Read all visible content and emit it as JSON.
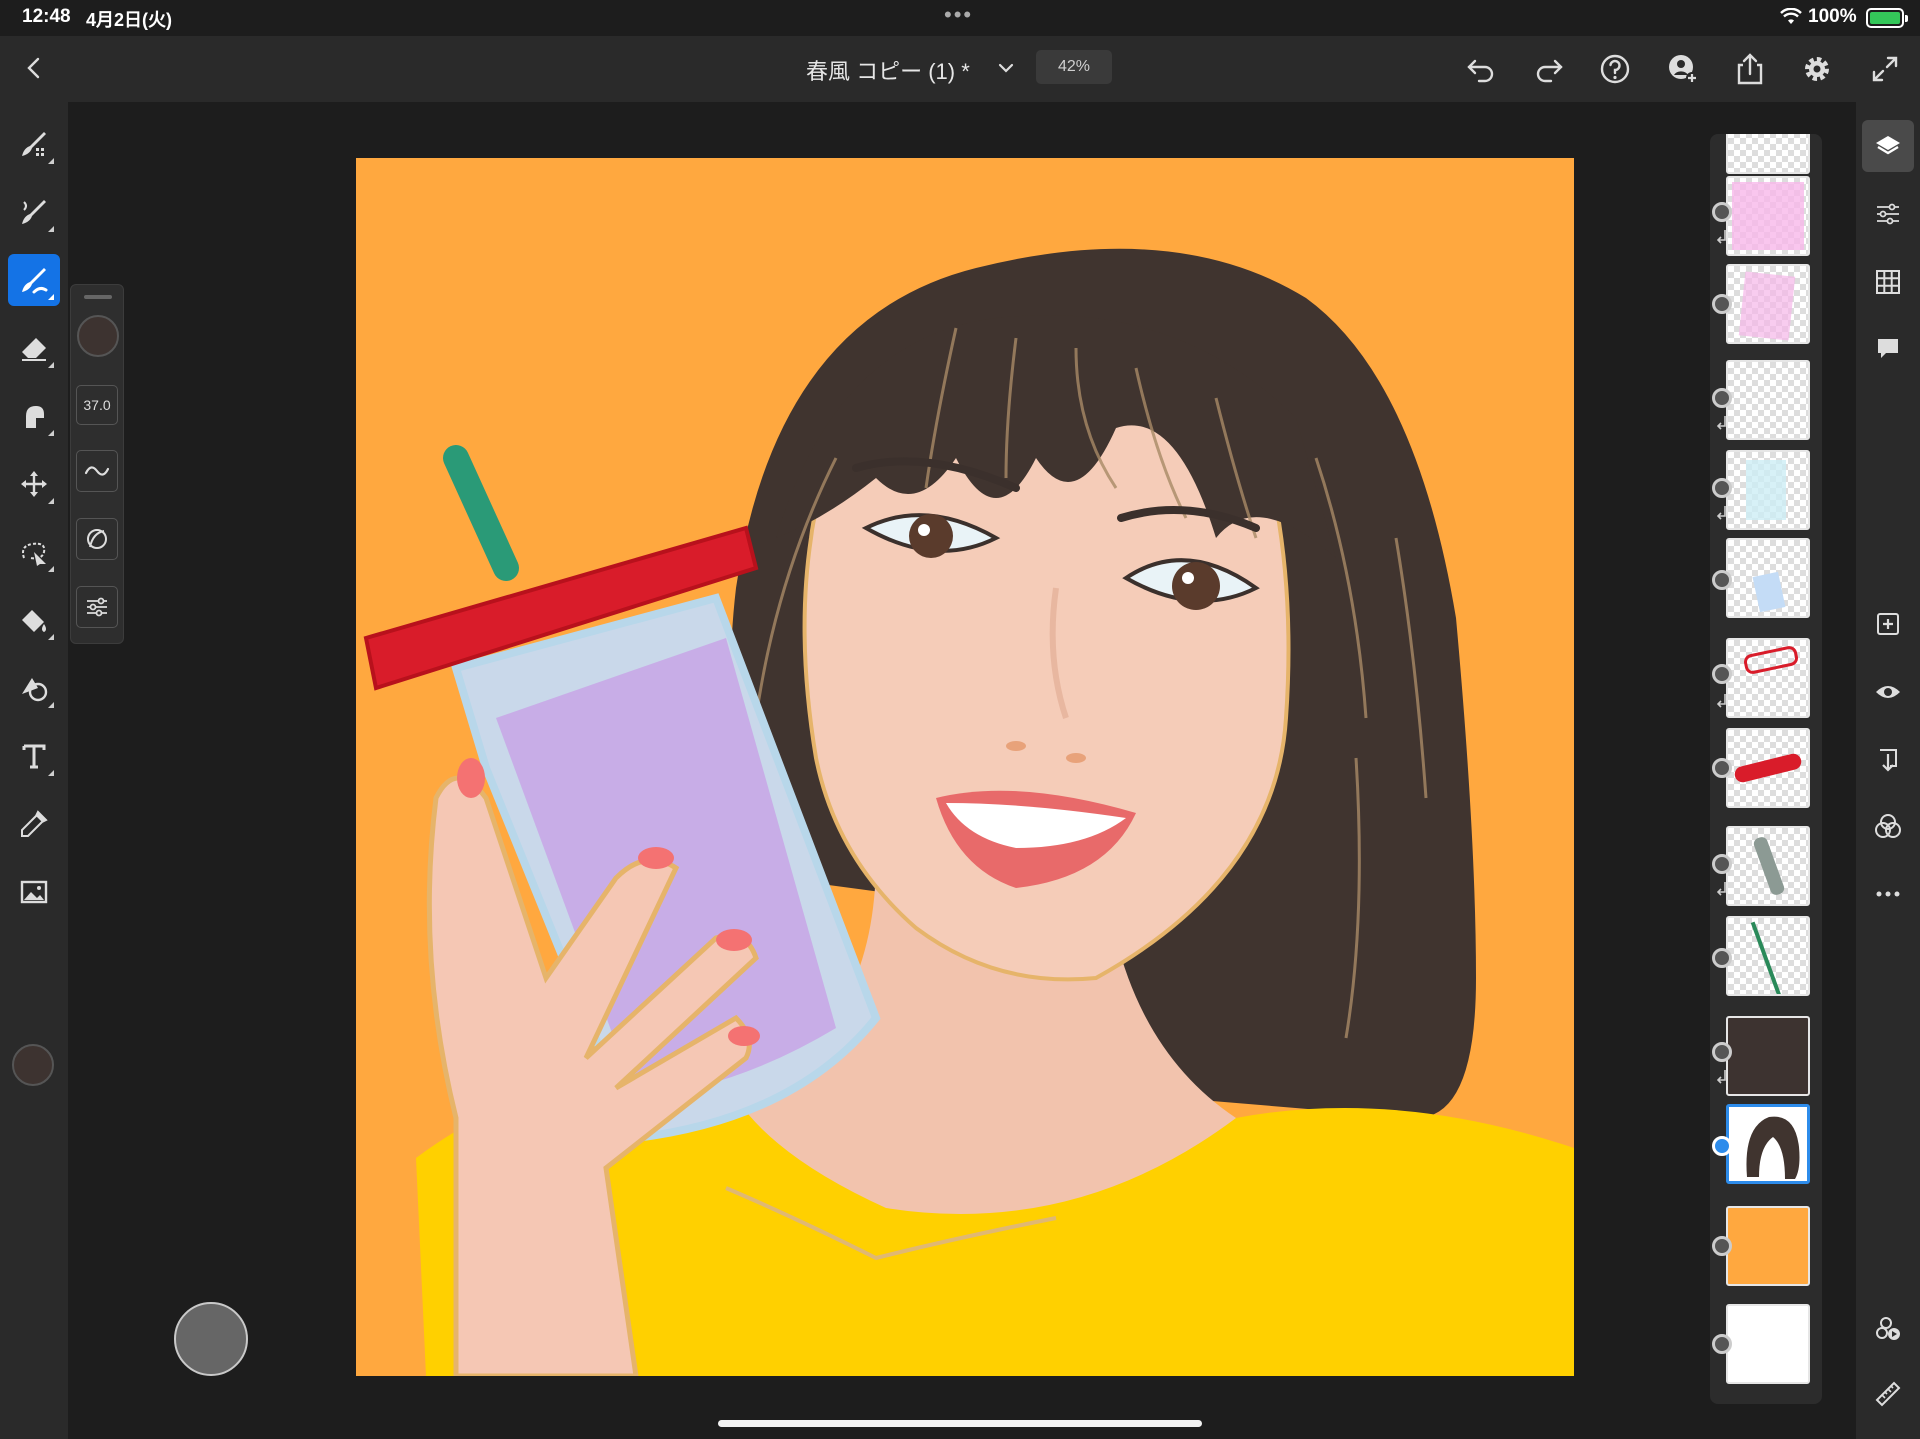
{
  "status_bar": {
    "time": "12:48",
    "date": "4月2日(火)",
    "dots": "•••",
    "battery_pct": "100%"
  },
  "header": {
    "document_title": "春風 コピー (1) *",
    "zoom": "42%"
  },
  "brush_panel": {
    "size_value": "37.0"
  },
  "colors": {
    "accent": "#1473e6",
    "current_color": "#3d3330",
    "canvas_background": "#ffa83f",
    "shirt": "#ffd000",
    "cup_lid": "#d91c2a"
  },
  "left_tools": [
    "pixel-brush-icon",
    "live-brush-icon",
    "paint-brush-icon",
    "eraser-icon",
    "smudge-icon",
    "move-transform-icon",
    "selection-icon",
    "fill-icon",
    "shape-icon",
    "text-icon",
    "eyedropper-icon",
    "image-import-icon"
  ],
  "right_tools": [
    "layers-icon",
    "layer-properties-icon",
    "grid-icon",
    "comments-icon",
    "add-layer-icon",
    "visibility-icon",
    "merge-down-icon",
    "blend-mode-icon",
    "more-icon",
    "reference-icon",
    "ruler-icon"
  ],
  "layers": [
    {
      "name": "layer-partial",
      "content": "transparent",
      "clipped": false
    },
    {
      "name": "layer-pink-fill",
      "content": "pink",
      "clipped": true
    },
    {
      "name": "layer-pink-stroke",
      "content": "pink-stroke",
      "clipped": false
    },
    {
      "name": "layer-empty",
      "content": "transparent",
      "clipped": true
    },
    {
      "name": "layer-light-blue",
      "content": "light-blue",
      "clipped": true
    },
    {
      "name": "layer-blue-shape",
      "content": "blue-shape",
      "clipped": false
    },
    {
      "name": "layer-red-outline",
      "content": "red-outline",
      "clipped": true
    },
    {
      "name": "layer-red-stroke",
      "content": "red-stroke",
      "clipped": false
    },
    {
      "name": "layer-gray-stroke",
      "content": "gray-stroke",
      "clipped": true
    },
    {
      "name": "layer-green-straw",
      "content": "green-line",
      "clipped": false
    },
    {
      "name": "layer-dark-fill",
      "content": "dark-brown",
      "clipped": true
    },
    {
      "name": "layer-hair",
      "content": "hair",
      "clipped": false,
      "selected": true
    },
    {
      "name": "layer-orange-bg",
      "content": "orange",
      "clipped": false
    },
    {
      "name": "layer-white-bg",
      "content": "white",
      "clipped": false
    }
  ]
}
